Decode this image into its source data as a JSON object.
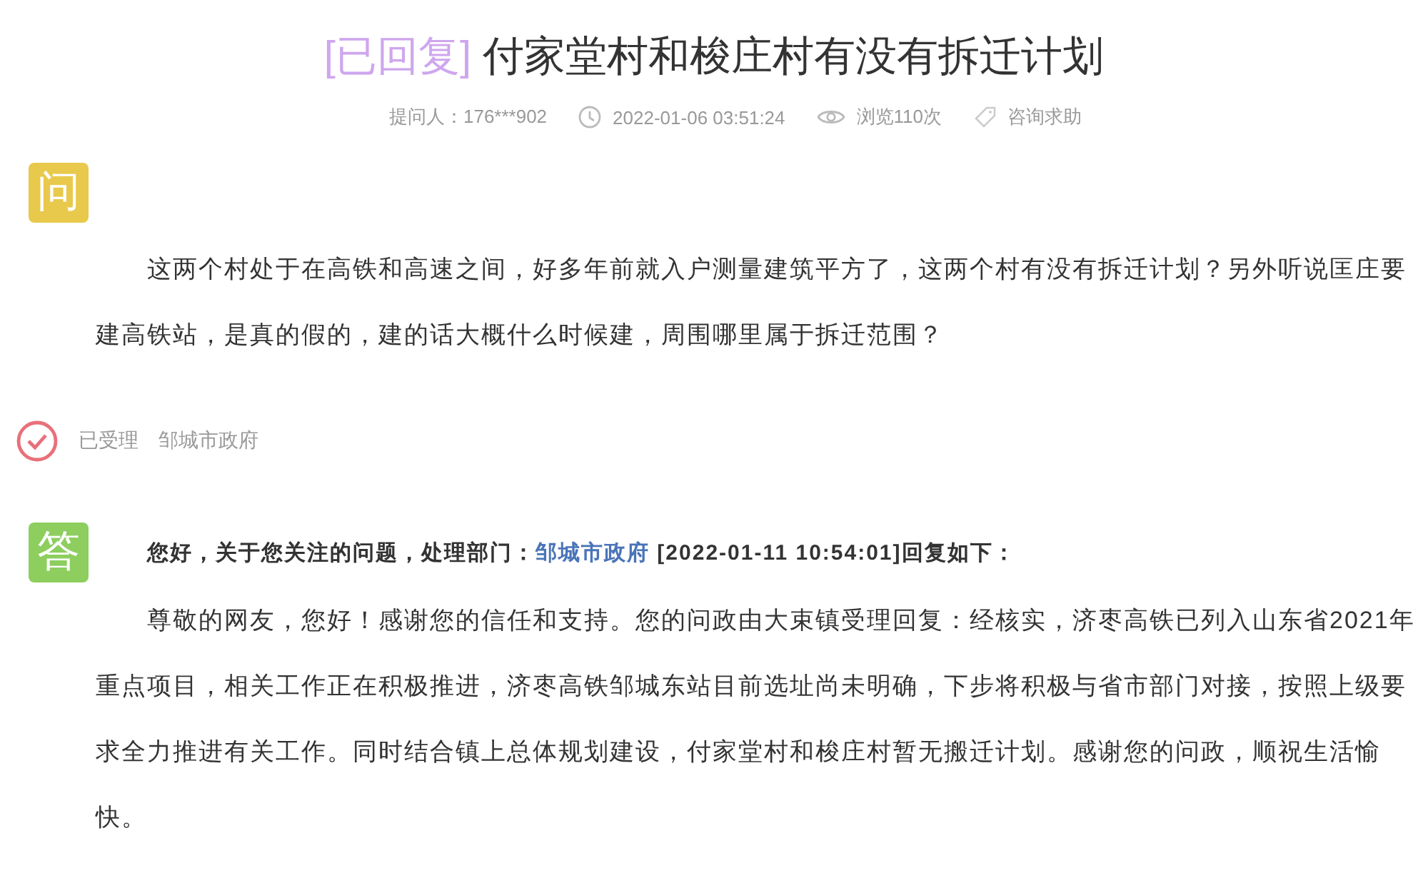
{
  "title": {
    "status": "[已回复]",
    "text": "付家堂村和梭庄村有没有拆迁计划"
  },
  "meta": [
    {
      "kind": "asker",
      "text": "提问人：176***902"
    },
    {
      "kind": "time",
      "text": "2022-01-06 03:51:24"
    },
    {
      "kind": "views",
      "text": "浏览110次"
    },
    {
      "kind": "category",
      "text": "咨询求助"
    }
  ],
  "question": {
    "badge": "问",
    "text": "这两个村处于在高铁和高速之间，好多年前就入户测量建筑平方了，这两个村有没有拆迁计划？另外听说匡庄要建高铁站，是真的假的，建的话大概什么时候建，周围哪里属于拆迁范围？"
  },
  "handling": {
    "state": "已受理",
    "department": "邹城市政府"
  },
  "answer": {
    "badge": "答",
    "intro": "您好，关于您关注的问题，处理部门：",
    "department": "邹城市政府",
    "suffix": "[2022-01-11 10:54:01]回复如下：",
    "text": "尊敬的网友，您好！感谢您的信任和支持。您的问政由大束镇受理回复：经核实，济枣高铁已列入山东省2021年重点项目，相关工作正在积极推进，济枣高铁邹城东站目前选址尚未明确，下步将积极与省市部门对接，按照上级要求全力推进有关工作。同时结合镇上总体规划建设，付家堂村和梭庄村暂无搬迁计划。感谢您的问政，顺祝生活愉快。"
  }
}
